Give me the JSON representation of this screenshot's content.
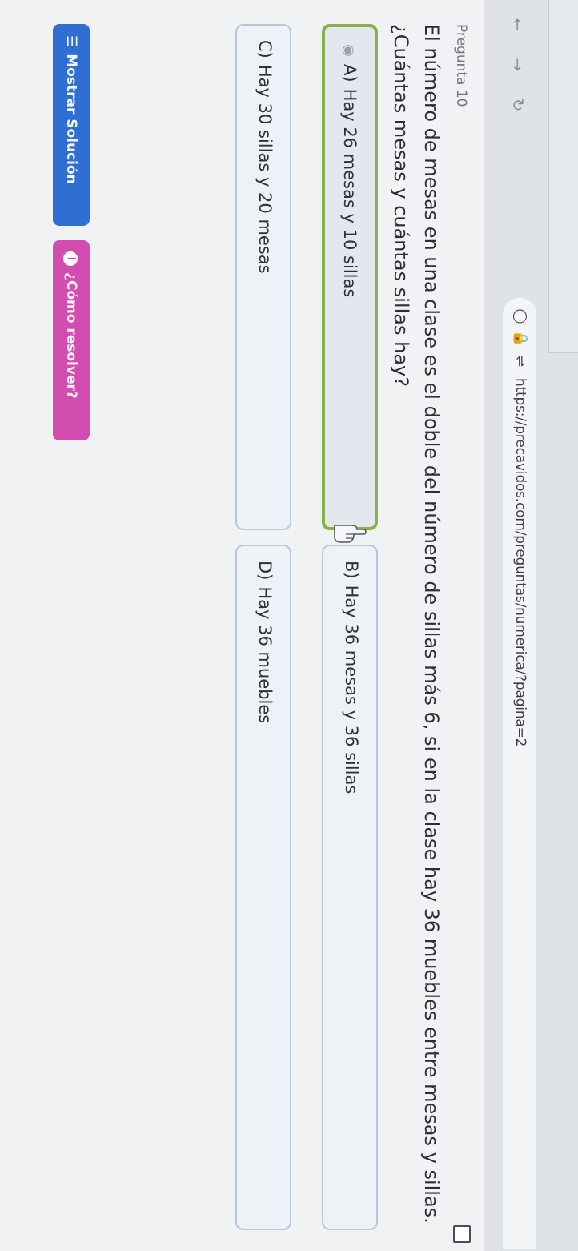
{
  "browser": {
    "url": "https://precavidos.com/preguntas/numerica/?pagina=2"
  },
  "question": {
    "number_label": "Pregunta 10",
    "text": "El número de mesas en una clase es el doble del número de sillas más 6, si en la clase hay 36 muebles entre mesas y sillas. ¿Cuántas mesas y cuántas sillas hay?"
  },
  "options": [
    {
      "letter": "A)",
      "text": "Hay 26 mesas y 10 sillas",
      "selected": true
    },
    {
      "letter": "B)",
      "text": "Hay 36 mesas y 36 sillas",
      "selected": false
    },
    {
      "letter": "C)",
      "text": "Hay 30 sillas y 20 mesas",
      "selected": false
    },
    {
      "letter": "D)",
      "text": "Hay 36 muebles",
      "selected": false
    }
  ],
  "buttons": {
    "show_solution": "Mostrar Solución",
    "how_to_solve": "¿Cómo resolver?"
  },
  "colors": {
    "selected_border": "#88b04b",
    "solution_button": "#2f6fd3",
    "howto_button": "#d34db1"
  }
}
